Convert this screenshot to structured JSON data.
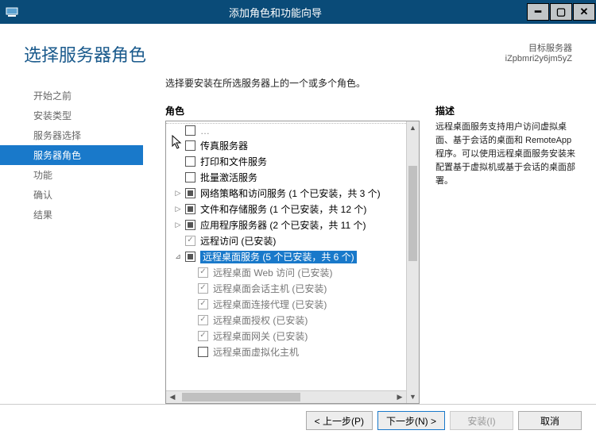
{
  "window": {
    "title": "添加角色和功能向导",
    "icon": "server-icon"
  },
  "header": {
    "page_title": "选择服务器角色",
    "target_label": "目标服务器",
    "target_value": "iZpbmri2y6jm5yZ"
  },
  "sidebar": {
    "items": [
      {
        "label": "开始之前",
        "active": false
      },
      {
        "label": "安装类型",
        "active": false
      },
      {
        "label": "服务器选择",
        "active": false
      },
      {
        "label": "服务器角色",
        "active": true
      },
      {
        "label": "功能",
        "active": false
      },
      {
        "label": "确认",
        "active": false
      },
      {
        "label": "结果",
        "active": false
      }
    ]
  },
  "main": {
    "instruction": "选择要安装在所选服务器上的一个或多个角色。",
    "roles_header": "角色",
    "desc_header": "描述",
    "roles": [
      {
        "indent": 0,
        "check": "none",
        "label": "传真服务器",
        "expandable": false
      },
      {
        "indent": 0,
        "check": "none",
        "label": "打印和文件服务",
        "expandable": false
      },
      {
        "indent": 0,
        "check": "none",
        "label": "批量激活服务",
        "expandable": false
      },
      {
        "indent": 0,
        "check": "partial",
        "label": "网络策略和访问服务 (1 个已安装，共 3 个)",
        "expandable": true,
        "arrow": "▷"
      },
      {
        "indent": 0,
        "check": "partial",
        "label": "文件和存储服务 (1 个已安装，共 12 个)",
        "expandable": true,
        "arrow": "▷"
      },
      {
        "indent": 0,
        "check": "partial",
        "label": "应用程序服务器 (2 个已安装，共 11 个)",
        "expandable": true,
        "arrow": "▷"
      },
      {
        "indent": 0,
        "check": "locked",
        "label": "远程访问 (已安装)",
        "expandable": false
      },
      {
        "indent": 0,
        "check": "partial",
        "label": "远程桌面服务 (5 个已安装，共 6 个)",
        "expandable": true,
        "arrow": "⊿",
        "selected": true
      },
      {
        "indent": 1,
        "check": "locked",
        "label": "远程桌面 Web 访问 (已安装)",
        "child": true
      },
      {
        "indent": 1,
        "check": "locked",
        "label": "远程桌面会话主机 (已安装)",
        "child": true
      },
      {
        "indent": 1,
        "check": "locked",
        "label": "远程桌面连接代理 (已安装)",
        "child": true
      },
      {
        "indent": 1,
        "check": "locked",
        "label": "远程桌面授权 (已安装)",
        "child": true
      },
      {
        "indent": 1,
        "check": "locked",
        "label": "远程桌面网关 (已安装)",
        "child": true
      },
      {
        "indent": 1,
        "check": "none",
        "label": "远程桌面虚拟化主机",
        "child": true
      }
    ],
    "description": "远程桌面服务支持用户访问虚拟桌面、基于会话的桌面和 RemoteApp 程序。可以使用远程桌面服务安装来配置基于虚拟机或基于会话的桌面部署。"
  },
  "footer": {
    "prev": "< 上一步(P)",
    "next": "下一步(N) >",
    "install": "安装(I)",
    "cancel": "取消"
  }
}
